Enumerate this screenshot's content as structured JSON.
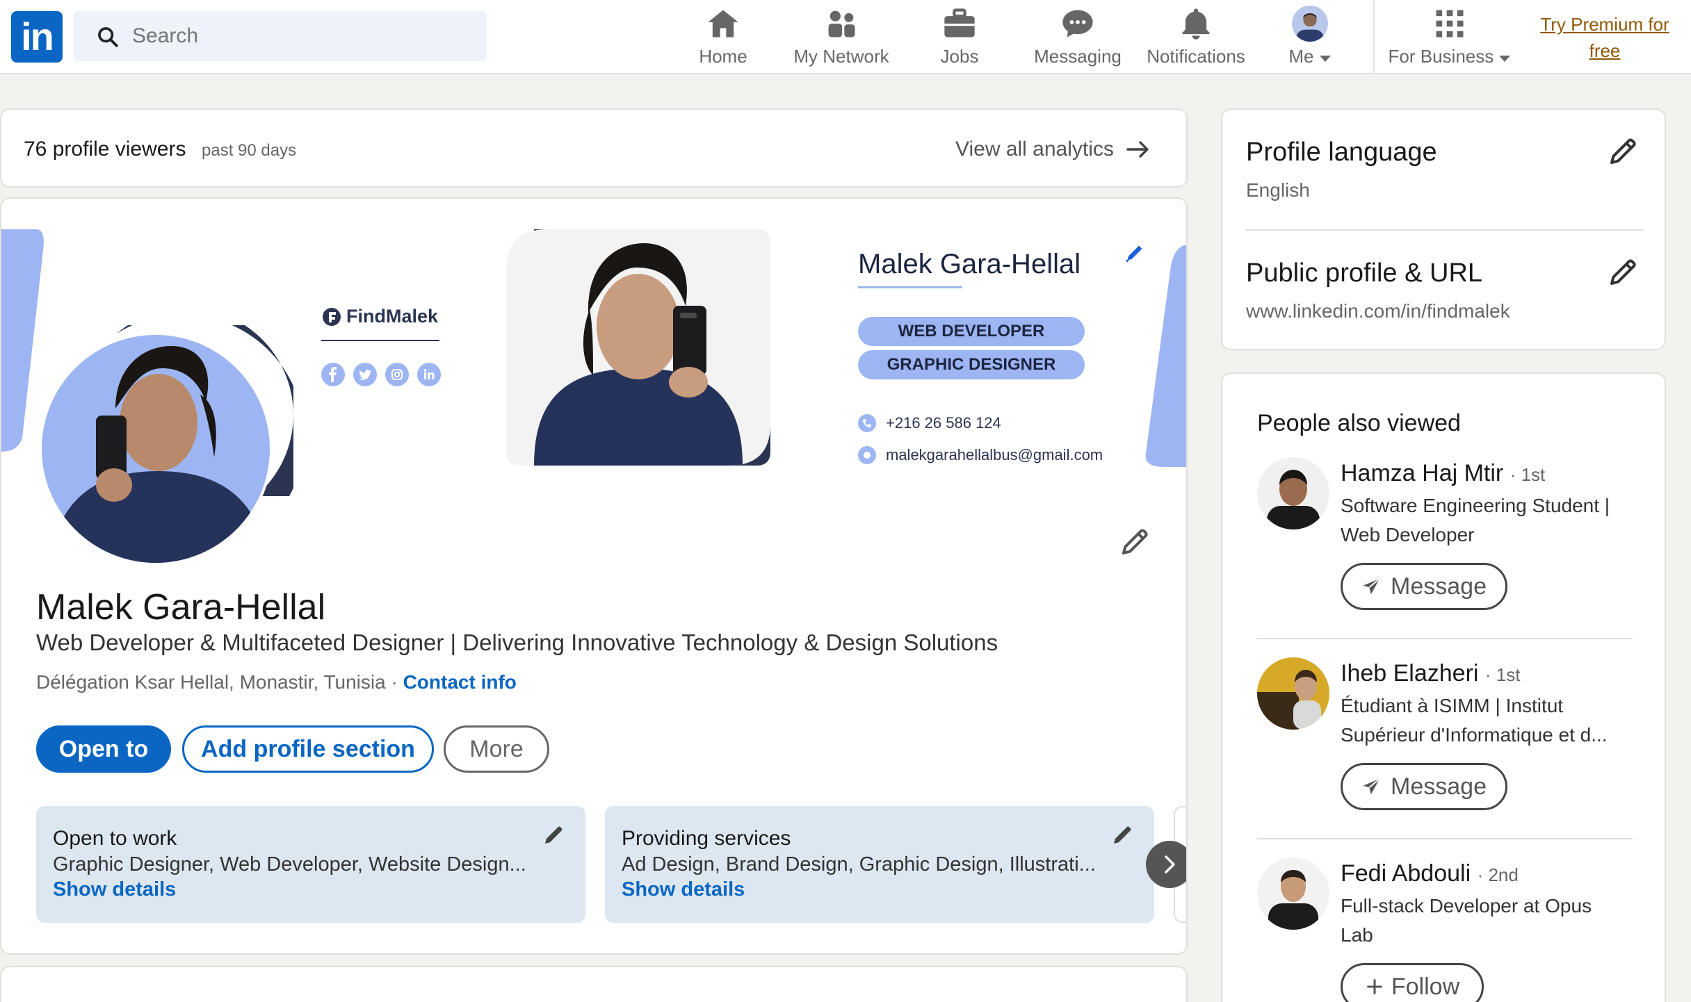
{
  "nav": {
    "logo": "in",
    "search_placeholder": "Search",
    "items": [
      {
        "label": "Home",
        "icon": "home-icon"
      },
      {
        "label": "My Network",
        "icon": "network-icon"
      },
      {
        "label": "Jobs",
        "icon": "briefcase-icon"
      },
      {
        "label": "Messaging",
        "icon": "messaging-icon"
      },
      {
        "label": "Notifications",
        "icon": "bell-icon"
      },
      {
        "label": "Me",
        "icon": "avatar"
      }
    ],
    "business_label": "For Business",
    "premium_line1": "Try Premium for",
    "premium_line2": "free"
  },
  "analytics": {
    "viewers": "76 profile viewers",
    "period": "past 90 days",
    "view_all": "View all analytics"
  },
  "banner": {
    "brand": "FindMalek",
    "name": "Malek Gara-Hellal",
    "role1": "WEB DEVELOPER",
    "role2": "GRAPHIC DESIGNER",
    "phone": "+216 26 586 124",
    "email": "malekgarahellalbus@gmail.com"
  },
  "profile": {
    "name": "Malek Gara-Hellal",
    "headline": "Web Developer & Multifaceted Designer | Delivering Innovative Technology & Design Solutions",
    "location": "Délégation Ksar Hellal, Monastir, Tunisia",
    "separator": "·",
    "contact": "Contact info",
    "open_to": "Open to",
    "add_section": "Add profile section",
    "more": "More"
  },
  "cards": [
    {
      "title": "Open to work",
      "text": "Graphic Designer, Web Developer, Website Design...",
      "link": "Show details"
    },
    {
      "title": "Providing services",
      "text": "Ad Design, Brand Design, Graphic Design, Illustrati...",
      "link": "Show details"
    }
  ],
  "sidebar": {
    "language_title": "Profile language",
    "language_value": "English",
    "url_title": "Public profile & URL",
    "url_value": "www.linkedin.com/in/findmalek",
    "pav_title": "People also viewed",
    "people": [
      {
        "name": "Hamza Haj Mtir",
        "degree": "· 1st",
        "line1": "Software Engineering Student |",
        "line2": "Web Developer",
        "action": "Message"
      },
      {
        "name": "Iheb Elazheri",
        "degree": "· 1st",
        "line1": "Étudiant à ISIMM | Institut",
        "line2": "Supérieur d'Informatique et d...",
        "action": "Message"
      },
      {
        "name": "Fedi Abdouli",
        "degree": "· 2nd",
        "line1": "Full-stack Developer at Opus",
        "line2": "Lab",
        "action": "Follow"
      }
    ]
  },
  "colors": {
    "brand": "#0a66c2",
    "premium": "#915907",
    "banner_accent": "#9db5f2"
  }
}
